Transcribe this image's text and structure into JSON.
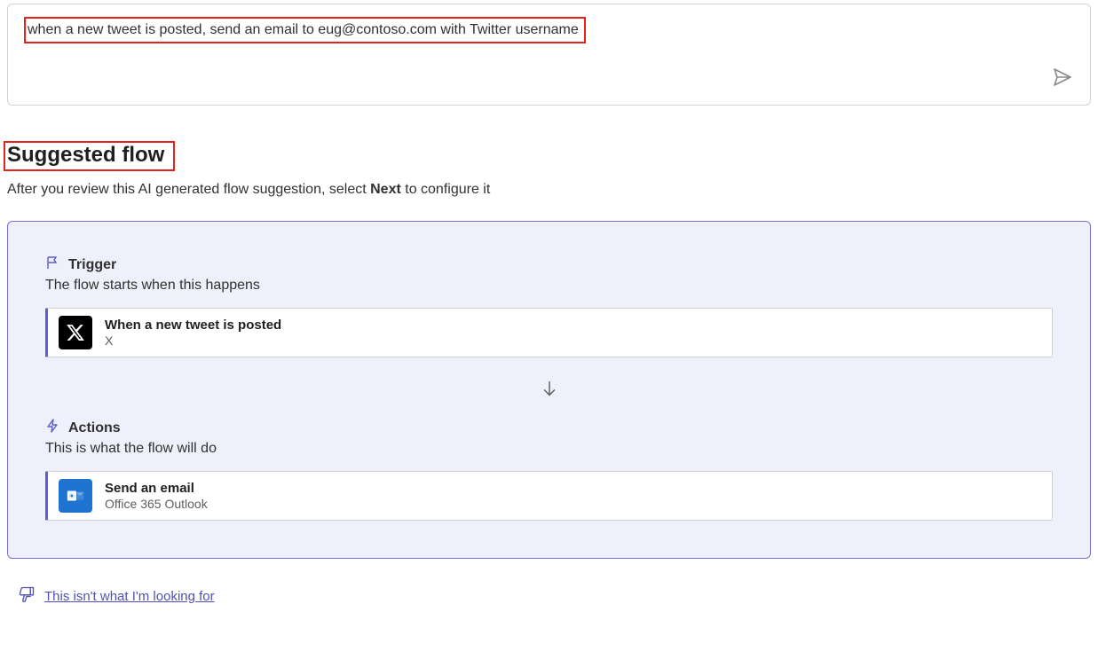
{
  "prompt": {
    "text": "when a new tweet is posted, send an email to eug@contoso.com with Twitter username",
    "send_label": "Send"
  },
  "heading": "Suggested flow",
  "subheading_before": "After you review this AI generated flow suggestion, select ",
  "subheading_bold": "Next",
  "subheading_after": " to configure it",
  "trigger": {
    "label": "Trigger",
    "desc": "The flow starts when this happens",
    "step": {
      "title": "When a new tweet is posted",
      "connector": "X"
    }
  },
  "actions": {
    "label": "Actions",
    "desc": "This is what the flow will do",
    "step": {
      "title": "Send an email",
      "connector": "Office 365 Outlook"
    }
  },
  "feedback": {
    "link": "This isn't what I'm looking for"
  }
}
